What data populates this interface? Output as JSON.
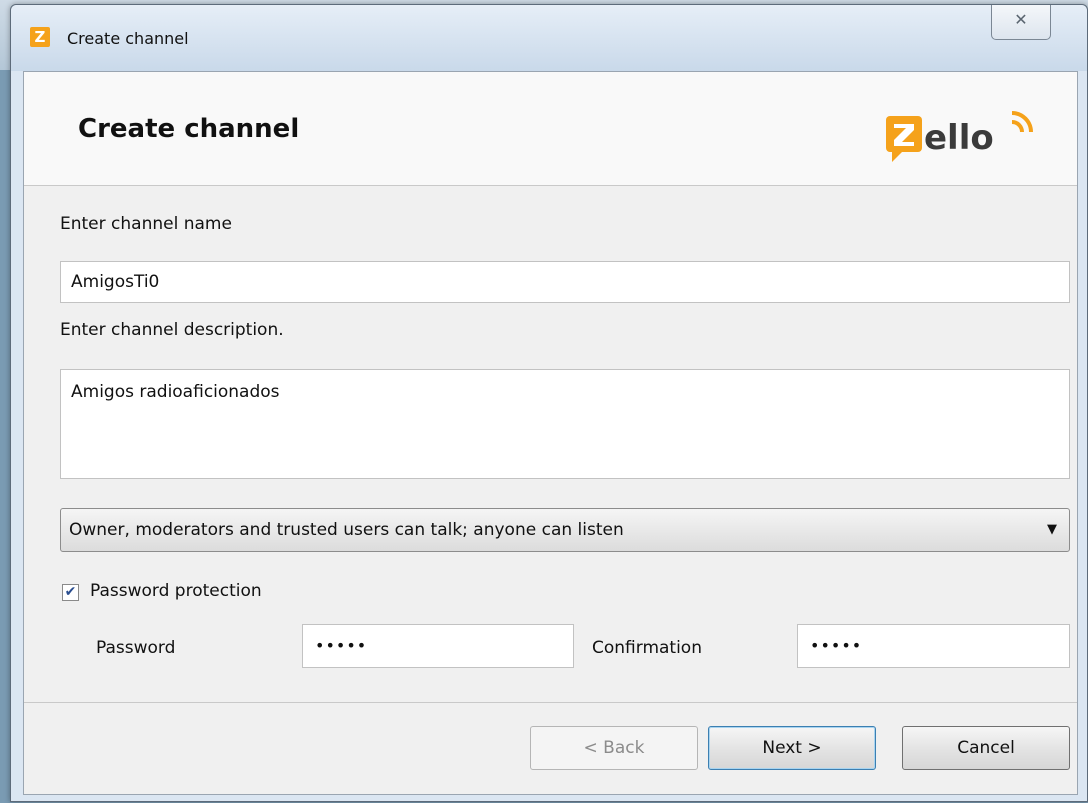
{
  "window": {
    "title": "Create channel",
    "close_glyph": "✕"
  },
  "header": {
    "title": "Create channel",
    "logo_text": "Zello"
  },
  "form": {
    "name_label": "Enter channel name",
    "name_value": "AmigosTi0",
    "description_label": "Enter channel description.",
    "description_value": "Amigos radioaficionados",
    "permission_selected": "Owner, moderators and trusted users can talk; anyone can listen",
    "password_protection_label": "Password protection",
    "password_protection_checked": true,
    "password_label": "Password",
    "password_value": "•••••",
    "confirmation_label": "Confirmation",
    "confirmation_value": "•••••"
  },
  "buttons": {
    "back": "< Back",
    "next": "Next >",
    "cancel": "Cancel"
  },
  "colors": {
    "logo_orange": "#f5a21b",
    "logo_dark": "#3b3b3b"
  }
}
